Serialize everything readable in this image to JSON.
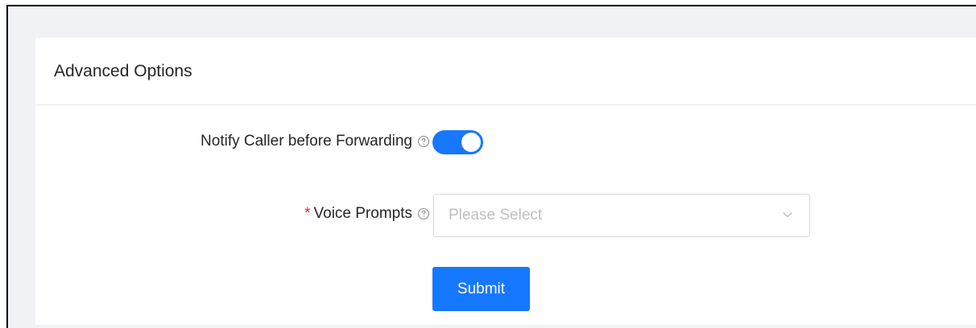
{
  "card": {
    "title": "Advanced Options"
  },
  "form": {
    "notify": {
      "label": "Notify Caller before Forwarding",
      "enabled": true
    },
    "voice_prompts": {
      "required_mark": "*",
      "label": "Voice Prompts",
      "placeholder": "Please Select"
    },
    "submit_label": "Submit"
  },
  "colors": {
    "primary": "#1677ff",
    "required": "#f5222d",
    "placeholder": "#bfbfbf",
    "background": "#f0f2f5"
  },
  "icons": {
    "help": "question-circle-icon",
    "dropdown": "chevron-down-icon"
  }
}
